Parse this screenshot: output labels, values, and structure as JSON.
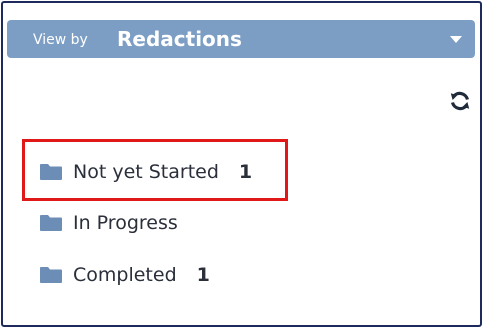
{
  "header": {
    "prefix": "View by",
    "title": "Redactions"
  },
  "icons": {
    "refresh": "refresh-icon",
    "folder": "folder-icon",
    "caret": "caret-down-icon"
  },
  "colors": {
    "header_bg": "#7d9ec4",
    "folder": "#6c8db5",
    "highlight": "#e01818"
  },
  "folders": [
    {
      "label": "Not yet Started",
      "count": "1",
      "highlighted": true
    },
    {
      "label": "In Progress",
      "count": ""
    },
    {
      "label": "Completed",
      "count": "1"
    }
  ]
}
